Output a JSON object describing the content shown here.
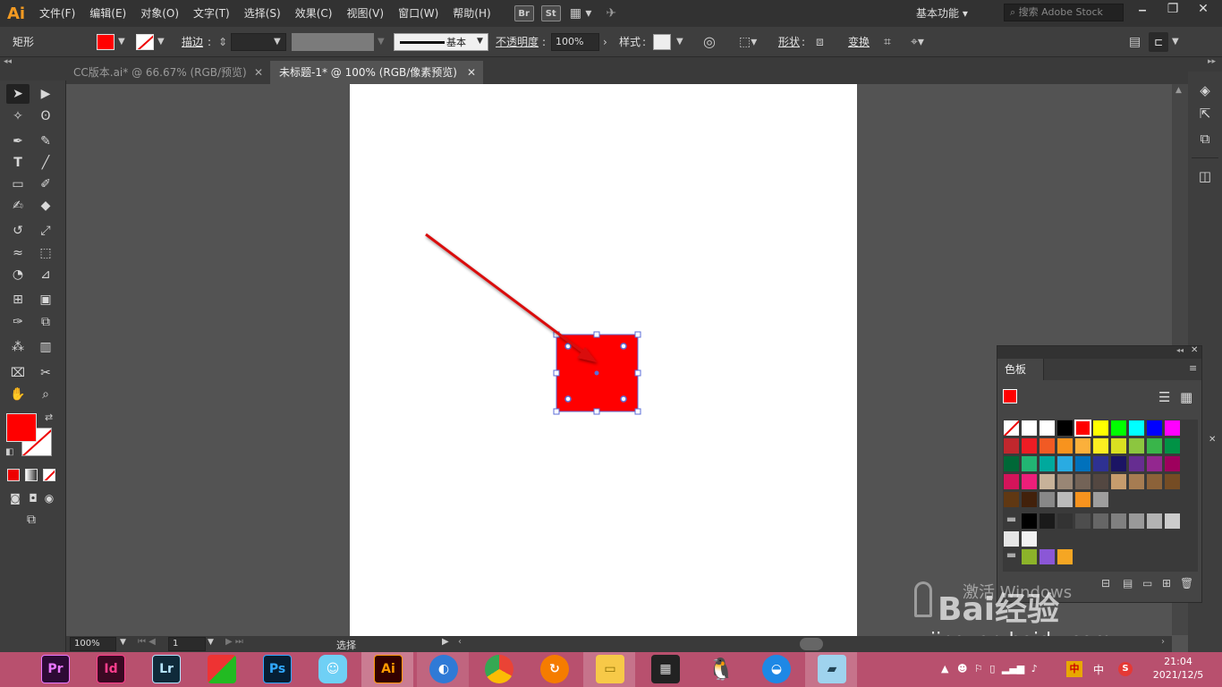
{
  "app": {
    "logo": "Ai"
  },
  "menu": [
    "文件(F)",
    "编辑(E)",
    "对象(O)",
    "文字(T)",
    "选择(S)",
    "效果(C)",
    "视图(V)",
    "窗口(W)",
    "帮助(H)"
  ],
  "title_icons": {
    "bridge": "Br",
    "stock": "St"
  },
  "workspace": {
    "label": "基本功能"
  },
  "search": {
    "placeholder": "搜索 Adobe Stock"
  },
  "control_bar": {
    "object_type": "矩形",
    "stroke_label": "描边",
    "stroke_style": "基本",
    "opacity_label": "不透明度",
    "opacity_value": "100%",
    "style_label": "样式",
    "shape_label": "形状",
    "transform_label": "变换",
    "colors": {
      "fill": "#ff0000"
    }
  },
  "tabs": [
    {
      "label": "CC版本.ai* @ 66.67% (RGB/预览)",
      "active": false
    },
    {
      "label": "未标题-1* @ 100% (RGB/像素预览)",
      "active": true
    }
  ],
  "status": {
    "zoom": "100%",
    "page": "1",
    "tool": "选择"
  },
  "swatches": {
    "title": "色板",
    "rows": [
      [
        "#ffffff",
        "#ffffff",
        "#ffffff",
        "#000000",
        "#ff0000",
        "#ffff00",
        "#00ff00",
        "#00ffff",
        "#0000ff",
        "#ff00ff"
      ],
      [
        "#c1272d",
        "#ed1c24",
        "#f15a24",
        "#f7931e",
        "#fbb03b",
        "#fcee21",
        "#d9e021",
        "#8cc63f",
        "#39b54a",
        "#009245"
      ],
      [
        "#006837",
        "#22b573",
        "#00a99d",
        "#29abe2",
        "#0071bc",
        "#2e3192",
        "#1b1464",
        "#662d91",
        "#93278f",
        "#9e005d"
      ],
      [
        "#d4145a",
        "#ed1e79",
        "#c7b299",
        "#998675",
        "#736357",
        "#534741",
        "#c69c6d",
        "#a67c52",
        "#8c6239",
        "#754c24"
      ],
      [
        "#603813",
        "#42210b",
        "#888888",
        "#bbbbbb",
        "#f7931e",
        "#9e9e9e"
      ],
      [
        "#000000",
        "#1a1a1a",
        "#333333",
        "#4d4d4d",
        "#666666",
        "#808080",
        "#999999",
        "#b3b3b3",
        "#cccccc"
      ],
      [
        "#e6e6e6",
        "#f2f2f2"
      ],
      [
        "#8cb32a",
        "#8b57d6",
        "#f5a623"
      ]
    ]
  },
  "watermark": {
    "activate": "激活 Windows",
    "brand": "Bai经验",
    "url": "jingyan.baidu.com"
  },
  "taskbar": {
    "apps": [
      "Pr",
      "Id",
      "Lr",
      "",
      "Ps",
      "",
      "Ai",
      "",
      "",
      "",
      "",
      "",
      "",
      "",
      ""
    ],
    "time": "21:04",
    "date": "2021/12/5",
    "ime": "中"
  }
}
